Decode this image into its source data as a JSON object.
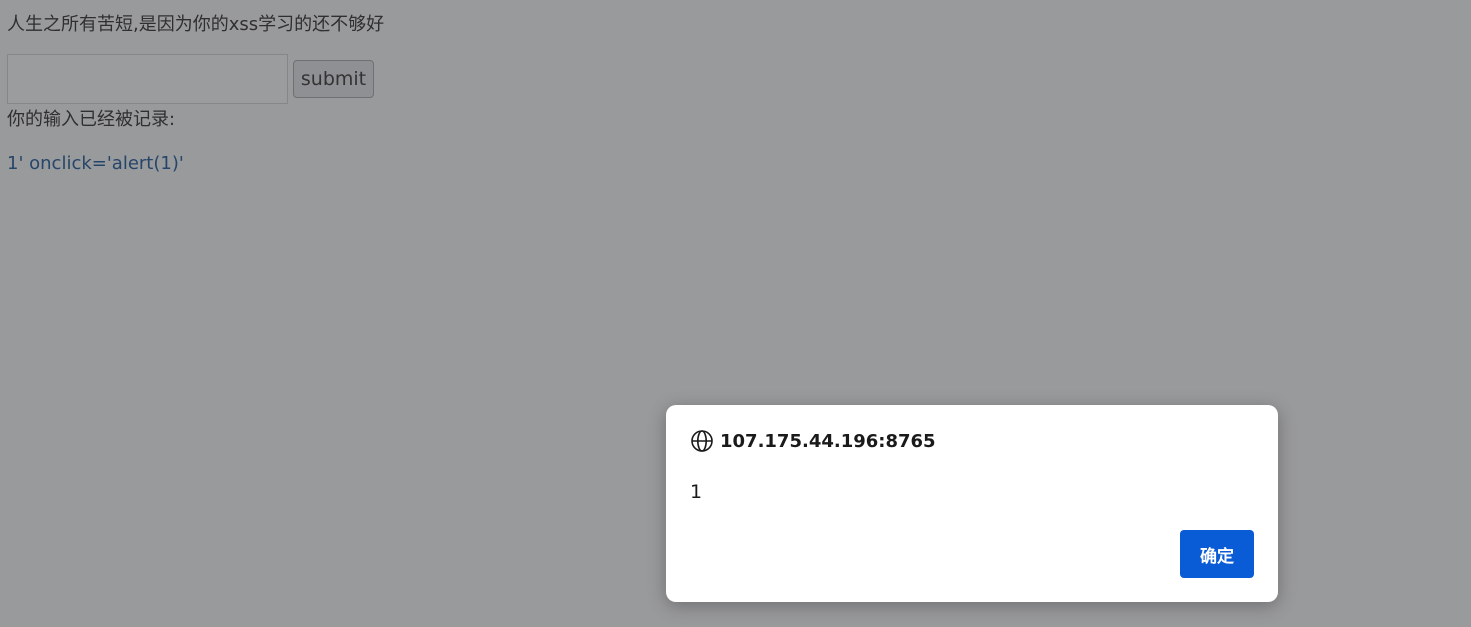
{
  "page": {
    "title": "人生之所有苦短,是因为你的xss学习的还不够好",
    "recorded_label": "你的输入已经被记录:",
    "recorded_value": "1' onclick='alert(1)'"
  },
  "form": {
    "input_value": "",
    "submit_label": "submit"
  },
  "dialog": {
    "origin": "107.175.44.196:8765",
    "icon": "globe-icon",
    "message": "1",
    "ok_label": "确定",
    "ok_color": "#0a5bd6"
  }
}
